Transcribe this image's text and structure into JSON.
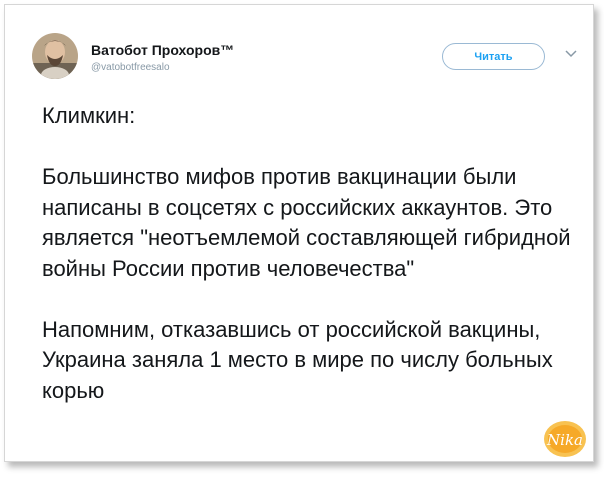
{
  "tweet": {
    "author": {
      "display_name": "Ватобот Прохоров™",
      "handle": "@vatobotfreesalo"
    },
    "follow_label": "Читать",
    "menu_icon": "chevron-down-icon",
    "text": "Климкин:\n\nБольшинство мифов против вакцинации были написаны в соцсетях с российских аккаунтов. Это является \"неотъемлемой составляющей гибридной войны России против человечества\"\n\nНапомним, отказавшись от российской вакцины, Украина заняла 1 место в мире по числу больных корью"
  },
  "watermark": {
    "text": "Nika",
    "icon": "site-logo"
  },
  "colors": {
    "accent": "#1da1f2",
    "text": "#14171a",
    "muted": "#8899a6",
    "watermark": "#f5a623"
  }
}
